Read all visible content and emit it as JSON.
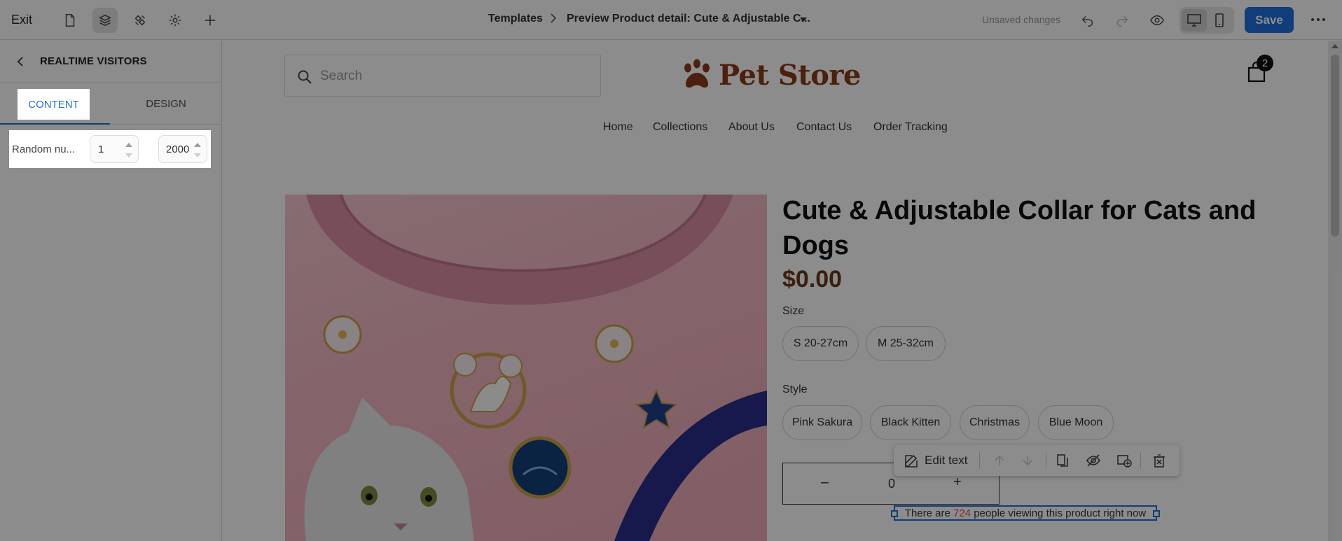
{
  "topbar": {
    "exit_label": "Exit",
    "breadcrumb_root": "Templates",
    "breadcrumb_current": "Preview Product detail: Cute & Adjustable C...",
    "unsaved_label": "Unsaved changes",
    "save_label": "Save",
    "accent_color": "#1f6fde",
    "icons": [
      "page-icon",
      "layers-icon",
      "apps-icon",
      "gear-icon",
      "plus-icon",
      "undo-icon",
      "redo-icon",
      "eye-icon",
      "desktop-icon",
      "mobile-icon",
      "more-icon"
    ]
  },
  "panel": {
    "title": "REALTIME VISITORS",
    "tabs": [
      {
        "label": "CONTENT",
        "active": true
      },
      {
        "label": "DESIGN",
        "active": false
      }
    ],
    "field": {
      "label": "Random nu...",
      "min_value": "1",
      "max_value": "2000"
    }
  },
  "store": {
    "search_placeholder": "Search",
    "logo_text": "Pet Store",
    "cart_count": "2",
    "nav": [
      "Home",
      "Collections",
      "About Us",
      "Contact Us",
      "Order Tracking"
    ],
    "product": {
      "title": "Cute & Adjustable Collar for Cats and Dogs",
      "price": "$0.00",
      "size_label": "Size",
      "sizes": [
        "S 20-27cm",
        "M 25-32cm"
      ],
      "style_label": "Style",
      "styles": [
        "Pink Sakura",
        "Black Kitten",
        "Christmas",
        "Blue Moon"
      ],
      "qty_minus": "–",
      "qty_value": "0",
      "qty_plus": "+"
    },
    "toolbar": {
      "edit_label": "Edit text"
    },
    "viewers": {
      "prefix": "There are",
      "count": "724",
      "suffix": "people viewing this product right now"
    }
  }
}
